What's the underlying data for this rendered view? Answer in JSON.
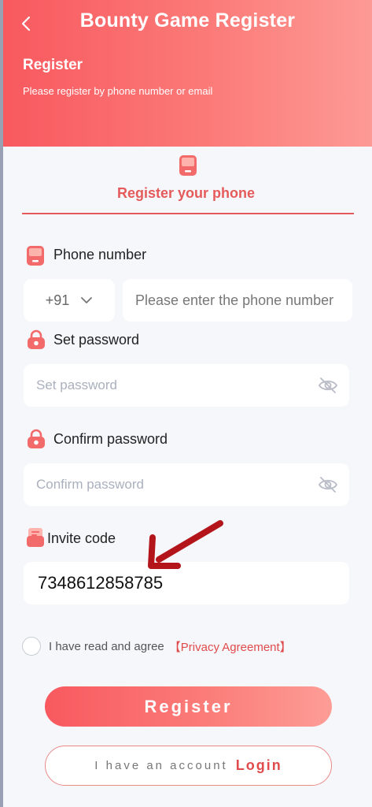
{
  "header": {
    "title": "Bounty Game Register",
    "heading": "Register",
    "subtitle": "Please register by phone number or email"
  },
  "tab": {
    "label": "Register your phone"
  },
  "phone": {
    "label": "Phone number",
    "country_code": "+91",
    "placeholder": "Please enter the phone number"
  },
  "password": {
    "label": "Set password",
    "placeholder": "Set password"
  },
  "confirm": {
    "label": "Confirm password",
    "placeholder": "Confirm password"
  },
  "invite": {
    "label": "Invite code",
    "value": "7348612858785"
  },
  "agreement": {
    "text": "I have read and agree",
    "link": "【Privacy Agreement】"
  },
  "buttons": {
    "register": "Register",
    "have_account": "I have an account",
    "login": "Login"
  },
  "colors": {
    "accent": "#e55a5a",
    "header_start": "#f8595f",
    "header_end": "#fd9a95",
    "arrow": "#b3151a"
  },
  "icons": {
    "back": "chevron-left-icon",
    "phone": "phone-icon",
    "lock": "lock-icon",
    "eye": "eye-off-icon",
    "invite": "invite-icon",
    "dropdown": "chevron-down-icon"
  }
}
